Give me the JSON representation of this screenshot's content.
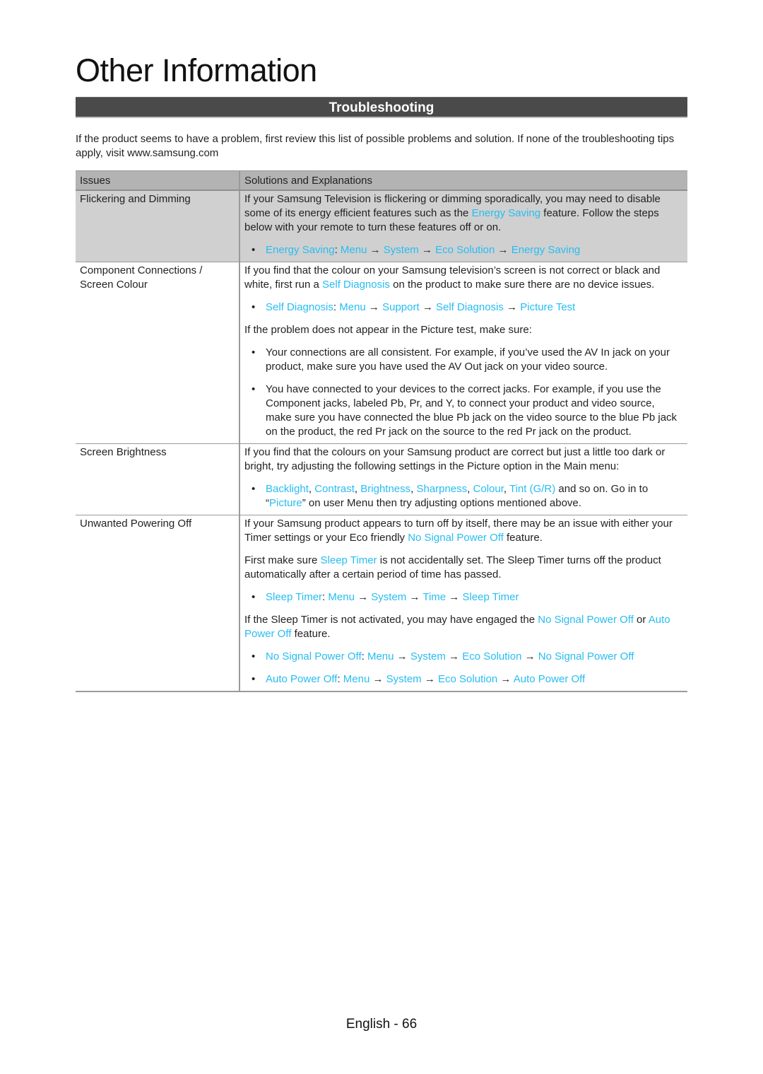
{
  "page": {
    "title": "Other Information",
    "section_title": "Troubleshooting",
    "intro": "If the product seems to have a problem, first review this list of possible problems and solution. If none of the troubleshooting tips apply, visit www.samsung.com",
    "footer": "English - 66"
  },
  "table": {
    "headers": [
      "Issues",
      "Solutions and Explanations"
    ],
    "link_color": "#27bdf2",
    "rows": [
      {
        "issue": "Flickering and Dimming",
        "p1_a": "If your Samsung Television is flickering or dimming sporadically, you may need to disable some of its energy efficient features such as the ",
        "p1_link": "Energy Saving",
        "p1_b": " feature. Follow the steps below with your remote to turn these features off or on.",
        "path": {
          "name": "Energy Saving",
          "steps": [
            "Menu",
            "System",
            "Eco Solution",
            "Energy Saving"
          ]
        }
      },
      {
        "issue": "Component Connections / Screen Colour",
        "p1_a": "If you find that the colour on your Samsung television’s screen is not correct or black and white, first run a ",
        "p1_link": "Self Diagnosis",
        "p1_b": " on the product to make sure there are no device issues.",
        "path": {
          "name": "Self Diagnosis",
          "steps": [
            "Menu",
            "Support",
            "Self Diagnosis",
            "Picture Test"
          ]
        },
        "p2": "If the problem does not appear in the Picture test, make sure:",
        "bullets": [
          "Your connections are all consistent. For example, if you’ve used the AV In jack on your product, make sure you have used the AV Out jack on your video source.",
          "You have connected to your devices to the correct jacks. For example, if you use the Component jacks, labeled Pb, Pr, and Y, to connect your product and video source, make sure you have connected the blue Pb jack on the video source to the blue Pb jack on the product, the red Pr jack on the source to the red Pr jack on the product."
        ]
      },
      {
        "issue": "Screen Brightness",
        "p1": "If you find that the colours on your Samsung product are correct but just a little too dark or bright, try adjusting the following settings in the Picture option in the Main menu:",
        "settings": [
          "Backlight",
          "Contrast",
          "Brightness",
          "Sharpness",
          "Colour",
          "Tint (G/R)"
        ],
        "settings_tail": " and so on. Go in to “",
        "picture_link": "Picture",
        "settings_end": "” on user Menu then try adjusting options mentioned above."
      },
      {
        "issue": "Unwanted Powering Off",
        "p1_a": "If your Samsung product appears to turn off by itself, there may be an issue with either your Timer settings or your Eco friendly ",
        "p1_link": "No Signal Power Off",
        "p1_b": " feature.",
        "p2_a": "First make sure ",
        "p2_link": "Sleep Timer",
        "p2_b": " is not accidentally set. The Sleep Timer turns off the product automatically after a certain period of time has passed.",
        "path1": {
          "name": "Sleep Timer",
          "steps": [
            "Menu",
            "System",
            "Time",
            "Sleep Timer"
          ]
        },
        "p3_a": "If the Sleep Timer is not activated, you may have engaged the ",
        "p3_link1": "No Signal Power Off",
        "p3_mid": " or ",
        "p3_link2": "Auto Power Off",
        "p3_b": " feature.",
        "path2": {
          "name": "No Signal Power Off",
          "steps": [
            "Menu",
            "System",
            "Eco Solution",
            "No Signal Power Off"
          ]
        },
        "path3": {
          "name": "Auto Power Off",
          "steps": [
            "Menu",
            "System",
            "Eco Solution",
            "Auto Power Off"
          ]
        }
      }
    ]
  },
  "symbols": {
    "bullet": "•",
    "arrow": " → ",
    "colon": ": ",
    "comma": ", "
  }
}
